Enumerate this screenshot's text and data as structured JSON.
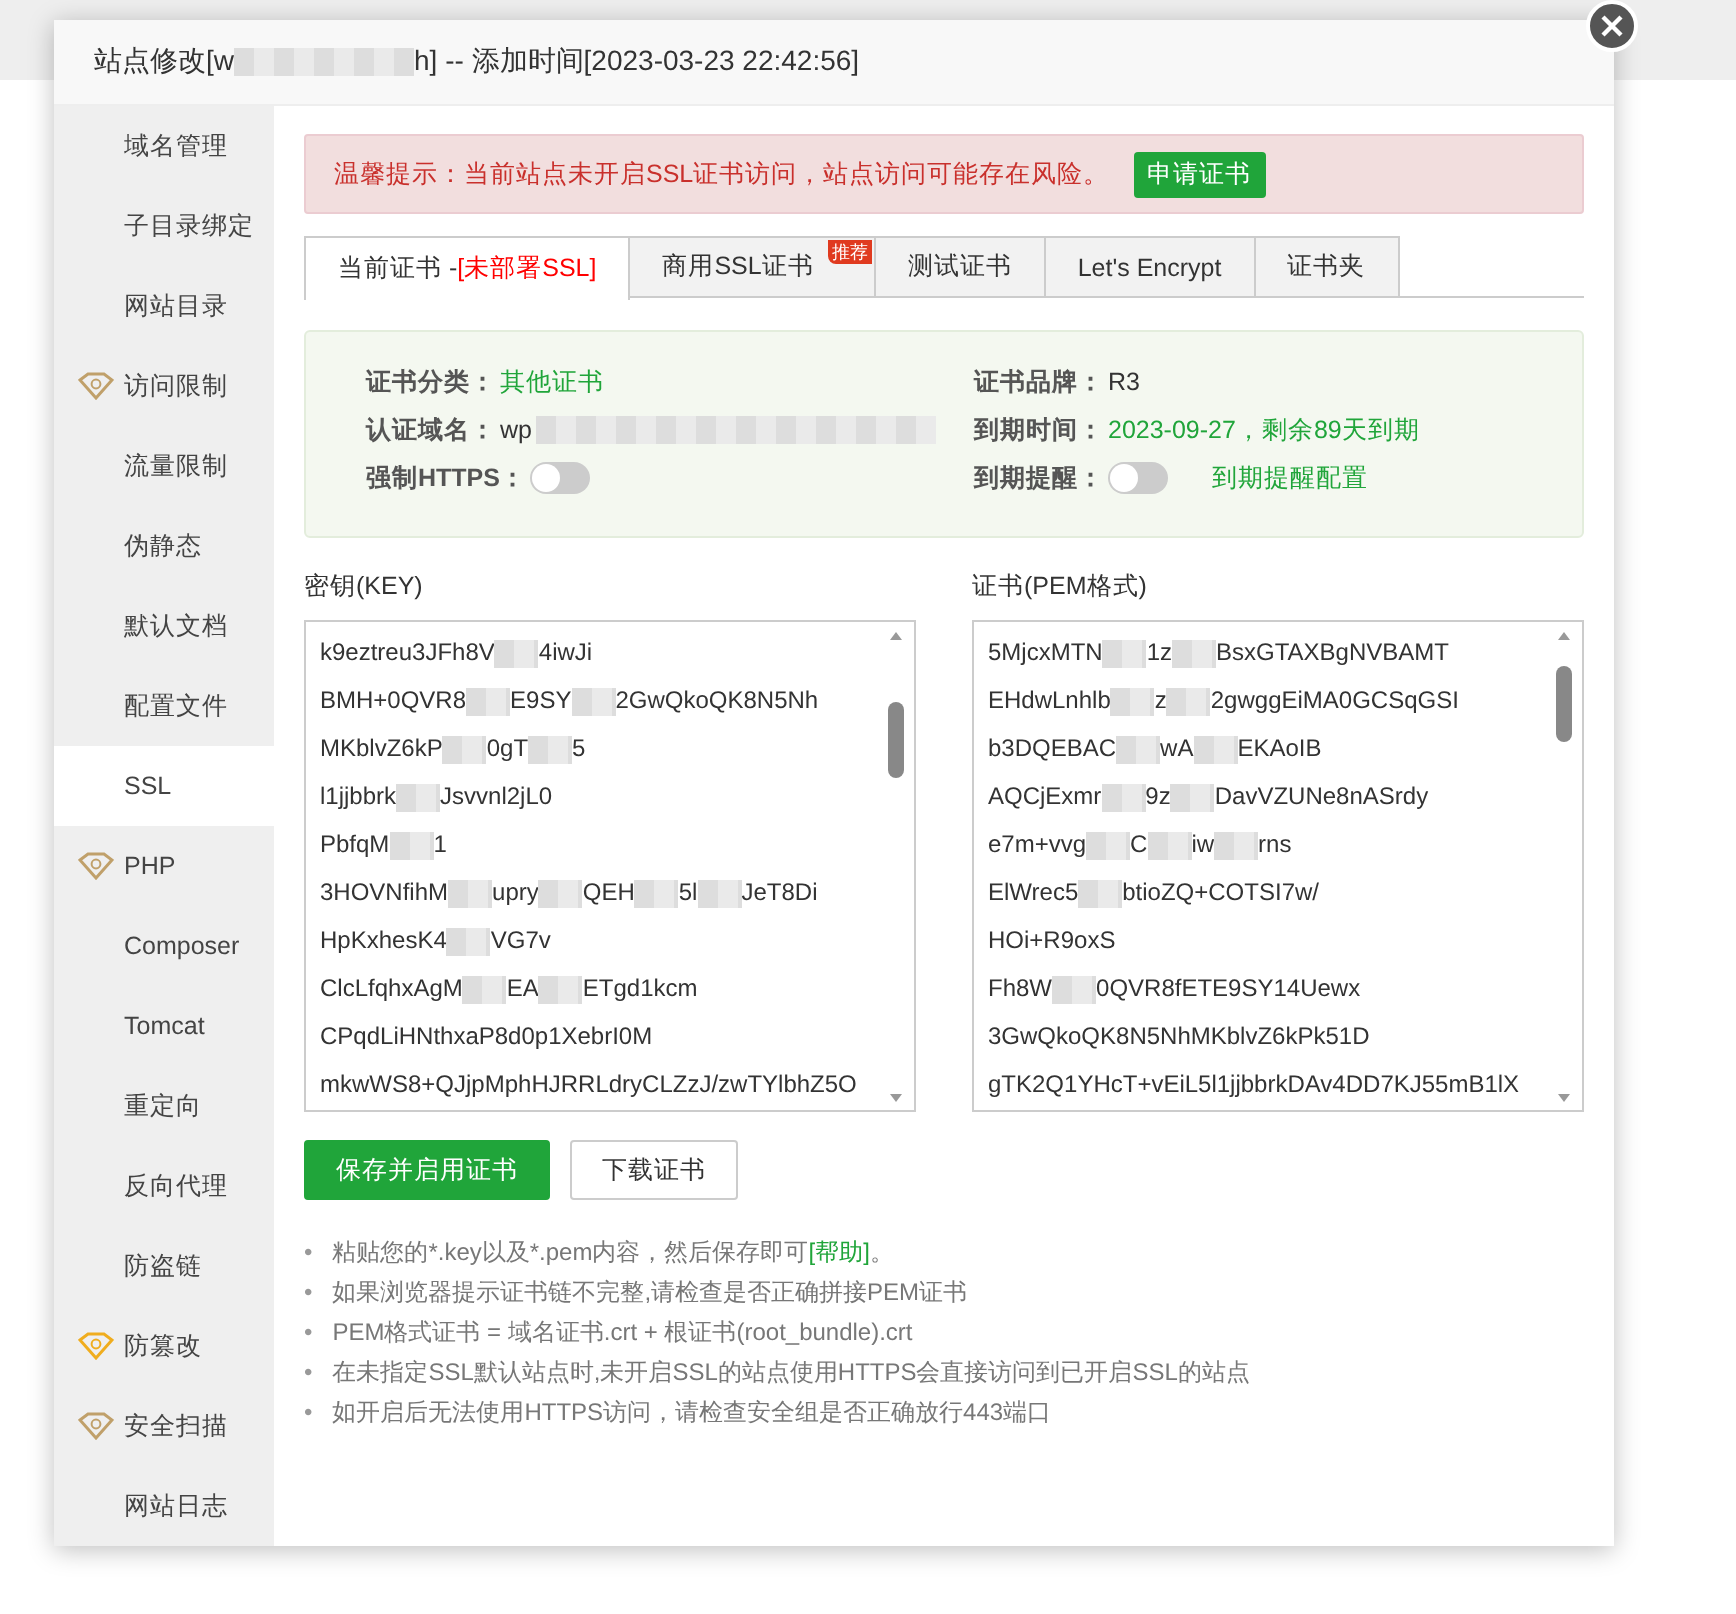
{
  "window": {
    "title_parts": [
      "站点修改[w",
      "h] -- 添加时间[2023-03-23 22:42:56]"
    ]
  },
  "sidebar": {
    "items": [
      {
        "label": "域名管理",
        "kind": "plain",
        "selected": false
      },
      {
        "label": "子目录绑定",
        "kind": "plain",
        "selected": false
      },
      {
        "label": "网站目录",
        "kind": "plain",
        "selected": false
      },
      {
        "label": "访问限制",
        "kind": "paid",
        "selected": false
      },
      {
        "label": "流量限制",
        "kind": "plain",
        "selected": false
      },
      {
        "label": "伪静态",
        "kind": "plain",
        "selected": false
      },
      {
        "label": "默认文档",
        "kind": "plain",
        "selected": false
      },
      {
        "label": "配置文件",
        "kind": "plain",
        "selected": false
      },
      {
        "label": "SSL",
        "kind": "plain",
        "selected": true
      },
      {
        "label": "PHP",
        "kind": "paid",
        "selected": false
      },
      {
        "label": "Composer",
        "kind": "plain",
        "selected": false
      },
      {
        "label": "Tomcat",
        "kind": "plain",
        "selected": false
      },
      {
        "label": "重定向",
        "kind": "plain",
        "selected": false
      },
      {
        "label": "反向代理",
        "kind": "plain",
        "selected": false
      },
      {
        "label": "防盗链",
        "kind": "plain",
        "selected": false
      },
      {
        "label": "防篡改",
        "kind": "pro",
        "selected": false
      },
      {
        "label": "安全扫描",
        "kind": "paid",
        "selected": false
      },
      {
        "label": "网站日志",
        "kind": "plain",
        "selected": false
      }
    ]
  },
  "alert": {
    "text": "温馨提示：当前站点未开启SSL证书访问，站点访问可能存在风险。",
    "button": "申请证书"
  },
  "tabs": [
    {
      "label": "当前证书 - ",
      "status": "[未部署SSL]",
      "selected": true
    },
    {
      "label": "商用SSL证书",
      "ribbon": "推荐",
      "selected": false
    },
    {
      "label": "测试证书",
      "selected": false
    },
    {
      "label": "Let's Encrypt",
      "selected": false
    },
    {
      "label": "证书夹",
      "selected": false
    }
  ],
  "cert_info": {
    "left": [
      {
        "kind": "text",
        "label": "证书分类：",
        "value": "其他证书",
        "highlight": true
      },
      {
        "kind": "blurred",
        "label": "认证域名：",
        "value": "wp"
      },
      {
        "kind": "toggle",
        "label": "强制HTTPS：",
        "on": false
      }
    ],
    "right": [
      {
        "kind": "text",
        "label": "证书品牌：",
        "value": "R3",
        "highlight": false
      },
      {
        "kind": "text",
        "label": "到期时间：",
        "value": "2023-09-27，剩余89天到期",
        "highlight": true
      },
      {
        "kind": "toggle",
        "label": "到期提醒：",
        "on": false,
        "link": "到期提醒配置"
      }
    ]
  },
  "key_box": {
    "label": "密钥(KEY)",
    "lines": [
      [
        "k9eztreu3JFh8V",
        "4iwJi"
      ],
      [
        "BMH+0QVR8",
        "E9SY",
        "2GwQkoQK8N5Nh"
      ],
      [
        "MKblvZ6kP",
        "0gT",
        "5"
      ],
      [
        "l1jjbbrk",
        "Jsvvnl2jL0"
      ],
      [
        "PbfqM",
        "1"
      ],
      [
        "3HOVNfihM",
        "upry",
        "QEH",
        "5l",
        "JeT8Di"
      ],
      [
        "HpKxhesK4",
        "VG7v"
      ],
      [
        "ClcLfqhxAgM",
        "EA",
        "ETgd1kcm"
      ],
      [
        "CPqdLiHNthxaP8d0p1XebrI0M"
      ],
      [
        "mkwWS8+QJjpMphHJRRLdryCLZzJ/zwTYlbhZ5O"
      ]
    ]
  },
  "pem_box": {
    "label": "证书(PEM格式)",
    "lines": [
      [
        "5MjcxMTN",
        "1z",
        "BsxGTAXBgNVBAMT"
      ],
      [
        "EHdwLnhlb",
        "z",
        "2gwggEiMA0GCSqGSI"
      ],
      [
        "b3DQEBAC",
        "wA",
        "EKAoIB"
      ],
      [
        "AQCjExmr",
        "9z",
        "DavVZUNe8nASrdy"
      ],
      [
        "e7m+vvg",
        "C",
        "iw",
        "rns"
      ],
      [
        "ElWrec5",
        "btioZQ+COTSI7w/"
      ],
      [
        "HOi+R9oxS"
      ],
      [
        "Fh8W",
        "0QVR8fETE9SY14Uewx"
      ],
      [
        "3GwQkoQK8N5NhMKblvZ6kPk51D"
      ],
      [
        "gTK2Q1YHcT+vEiL5l1jjbbrkDAv4DD7KJ55mB1lX"
      ]
    ]
  },
  "buttons": [
    {
      "label": "保存并启用证书",
      "kind": "primary"
    },
    {
      "label": "下载证书",
      "kind": "default"
    }
  ],
  "tips": [
    {
      "marker": "•",
      "text": "粘贴您的*.key以及*.pem内容，然后保存即可",
      "link": "[帮助]",
      "tail": "。"
    },
    {
      "marker": "•",
      "text": "如果浏览器提示证书链不完整,请检查是否正确拼接PEM证书"
    },
    {
      "marker": "•",
      "text": "PEM格式证书 = 域名证书.crt + 根证书(root_bundle).crt"
    },
    {
      "marker": "•",
      "text": "在未指定SSL默认站点时,未开启SSL的站点使用HTTPS会直接访问到已开启SSL的站点"
    },
    {
      "marker": "•",
      "text": "如开启后无法使用HTTPS访问，请检查安全组是否正确放行443端口"
    }
  ]
}
